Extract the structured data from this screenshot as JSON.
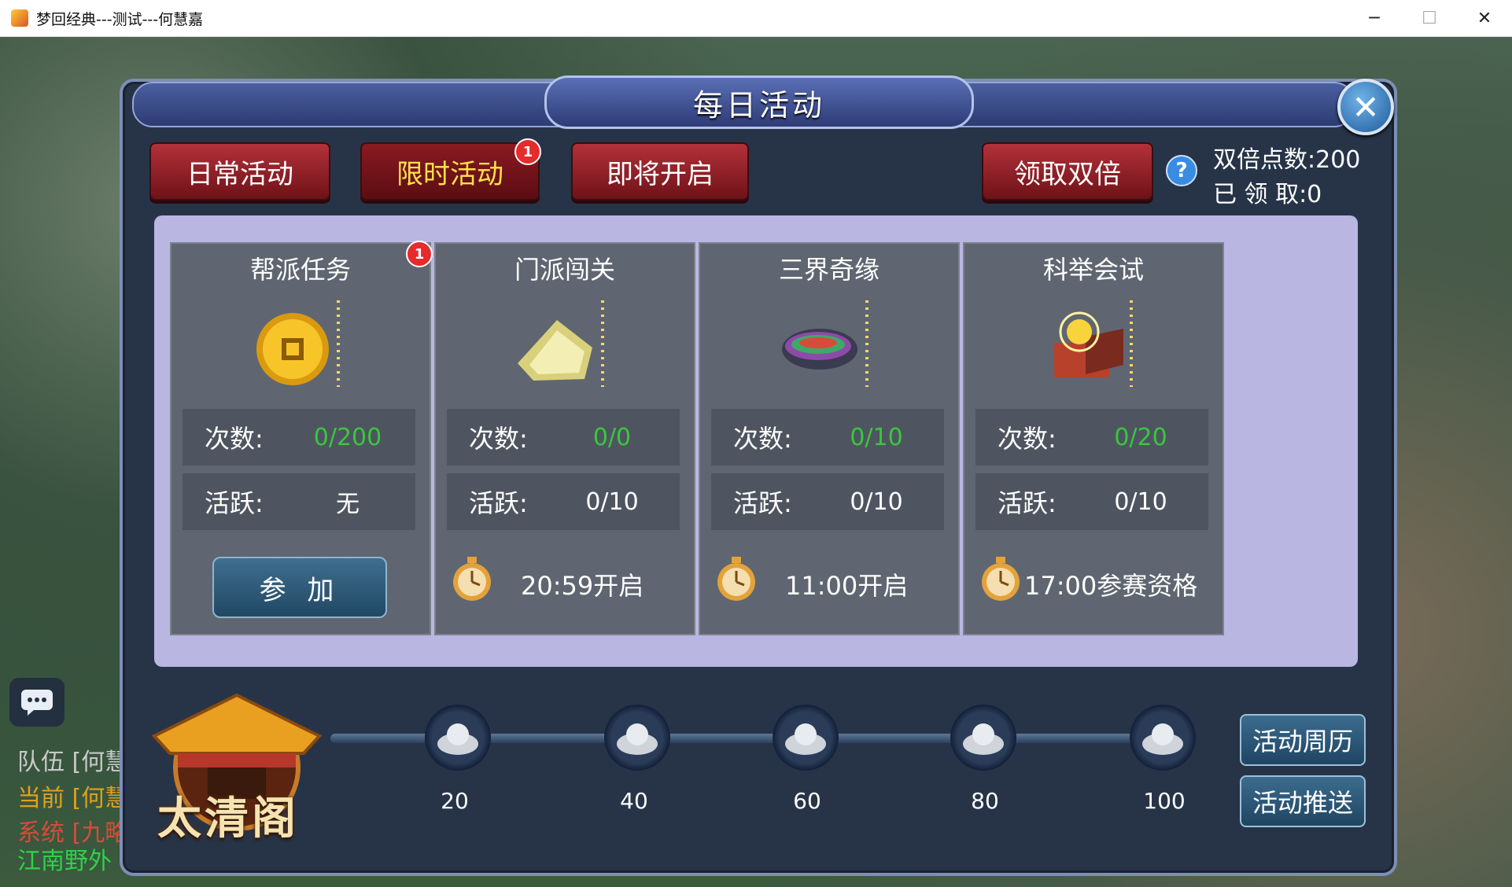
{
  "window": {
    "title": "梦回经典---测试---何慧嘉",
    "minimize": "─",
    "maximize": "☐",
    "close": "✕"
  },
  "panel": {
    "title": "每日活动",
    "close_glyph": "✕"
  },
  "tabs": [
    {
      "label": "日常活动",
      "active": false
    },
    {
      "label": "限时活动",
      "active": true,
      "badge": "1"
    },
    {
      "label": "即将开启",
      "active": false
    }
  ],
  "double": {
    "button_label": "领取双倍",
    "help_glyph": "?",
    "points": "双倍点数:200",
    "claimed": "已 领 取:0"
  },
  "cards": [
    {
      "title": "帮派任务",
      "icon": "gold-coin-icon",
      "badge": "1",
      "count_label": "次数:",
      "count_value": "0/200",
      "active_label": "活跃:",
      "active_value": "无",
      "action": "参 加"
    },
    {
      "title": "门派闯关",
      "icon": "jade-stone-icon",
      "count_label": "次数:",
      "count_value": "0/0",
      "active_label": "活跃:",
      "active_value": "0/10",
      "open_text": "20:59开启"
    },
    {
      "title": "三界奇缘",
      "icon": "rainbow-shoe-icon",
      "count_label": "次数:",
      "count_value": "0/10",
      "active_label": "活跃:",
      "active_value": "0/10",
      "open_text": "11:00开启"
    },
    {
      "title": "科举会试",
      "icon": "treasure-box-icon",
      "count_label": "次数:",
      "count_value": "0/20",
      "active_label": "活跃:",
      "active_value": "0/10",
      "open_text": "17:00参赛资格"
    }
  ],
  "milestones": [
    "20",
    "40",
    "60",
    "80",
    "100"
  ],
  "side_buttons": {
    "calendar": "活动周历",
    "push": "活动推送"
  },
  "shop": {
    "title": "太清阁"
  },
  "chat": {
    "lines": [
      {
        "text": "队伍 [何慧",
        "color": "#c9c9c9"
      },
      {
        "text": "当前 [何慧",
        "color": "#e0a020"
      },
      {
        "text": "系统 [九略",
        "color": "#d84b3a"
      },
      {
        "text": "江南野外",
        "color": "#2fd14a"
      }
    ]
  },
  "colors": {
    "tab_red": "#8a1a22",
    "active_tab_text": "#ffe14a",
    "count_green": "#37c83c",
    "content_bg": "#b9b6e2",
    "card_bg": "#5f6671"
  }
}
